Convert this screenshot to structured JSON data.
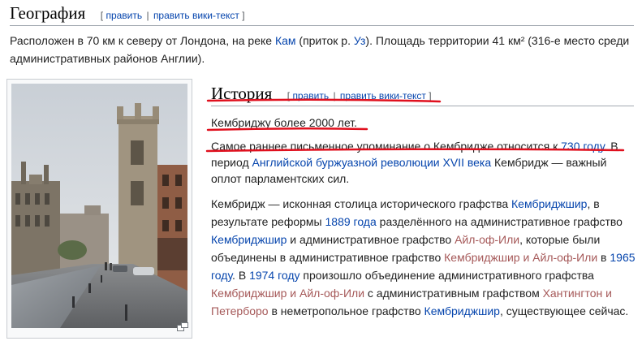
{
  "sections": {
    "geography": {
      "title": "География",
      "edit_open": "[",
      "edit_label": "править",
      "edit_sep": "|",
      "edit_source_label": "править вики-текст",
      "edit_close": "]"
    },
    "history": {
      "title": "История",
      "edit_open": "[",
      "edit_label": "править",
      "edit_sep": "|",
      "edit_source_label": "править вики-текст",
      "edit_close": "]"
    }
  },
  "geography_text": {
    "t1": "Расположен в 70 км к северу от Лондона, на реке ",
    "link_cam": "Кам",
    "t2": " (приток р. ",
    "link_ouse": "Уз",
    "t3": "). Площадь территории 41 км² (316-е место среди административных районов Англии)."
  },
  "history_text": {
    "p1": "Кембриджу более 2000 лет.",
    "p2_t1": "Самое раннее письменное упоминание о Кембридже относится к ",
    "p2_link_730": "730 году",
    "p2_t2": ". В период ",
    "p2_link_revolution": "Английской буржуазной революции XVII века",
    "p2_t3": " Кембридж — важный оплот парламентских сил.",
    "p3_t1": "Кембридж — исконная столица исторического графства ",
    "p3_link_cambs": "Кембриджшир",
    "p3_t2": ", в результате реформы ",
    "p3_link_1889": "1889 года",
    "p3_t3": " разделённого на административное графство ",
    "p3_link_cambs2": "Кембриджшир",
    "p3_t4": " и административное графство ",
    "p3_link_ely": "Айл-оф-Или",
    "p3_t5": ", которые были объединены в административное графство ",
    "p3_link_cambs_ely": "Кембриджшир и Айл-оф-Или",
    "p3_t6": " в ",
    "p3_link_1965": "1965 году",
    "p3_t7": ". В ",
    "p3_link_1974": "1974 году",
    "p3_t8": " произошло объединение административного графства ",
    "p3_link_cambs_ely2": "Кембриджшир и Айл-оф-Или",
    "p3_t9": " с административным графством ",
    "p3_link_hunt": "Хантингтон и Петерборо",
    "p3_t10": " в неметропольное графство ",
    "p3_link_cambs3": "Кембриджшир",
    "p3_t11": ", существующее сейчас."
  },
  "icons": {
    "thumbnail": "cambridge-street-photo",
    "magnify": "magnify-icon"
  },
  "colors": {
    "link": "#0645ad",
    "redlink": "#a55858",
    "annotation_underline": "#e0101e"
  }
}
